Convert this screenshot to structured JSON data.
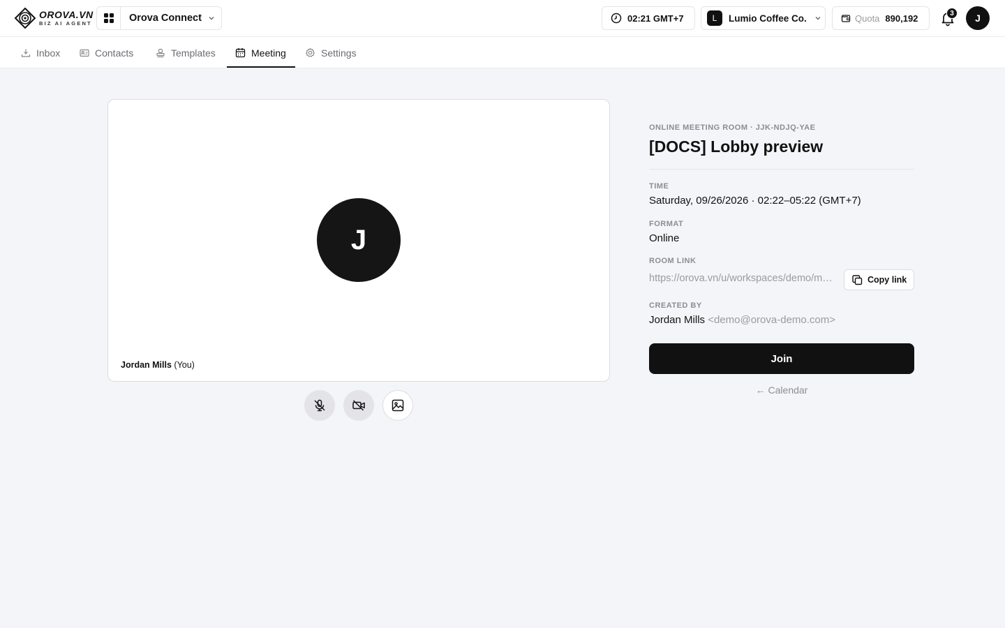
{
  "header": {
    "logo_main": "OROVA.VN",
    "logo_sub": "BIZ AI AGENT",
    "app_name": "Orova Connect",
    "time": "02:21 GMT+7",
    "org_initial": "L",
    "org_name": "Lumio Coffee Co.",
    "quota_label": "Quota",
    "quota_value": "890,192",
    "notification_count": "3",
    "user_initial": "J"
  },
  "tabs": [
    {
      "label": "Inbox",
      "icon": "inbox-icon",
      "active": false
    },
    {
      "label": "Contacts",
      "icon": "contact-card-icon",
      "active": false
    },
    {
      "label": "Templates",
      "icon": "stamp-icon",
      "active": false
    },
    {
      "label": "Meeting",
      "icon": "calendar-icon",
      "active": true
    },
    {
      "label": "Settings",
      "icon": "gear-icon",
      "active": false
    }
  ],
  "preview": {
    "avatar_initial": "J",
    "name": "Jordan Mills",
    "you_tag": "(You)",
    "mic_state": "muted",
    "camera_state": "off"
  },
  "meeting": {
    "room_id": "ONLINE MEETING ROOM · JJK-NDJQ-YAE",
    "title": "[DOCS] Lobby preview",
    "time_label": "TIME",
    "time_value": "Saturday, 09/26/2026 · 02:22–05:22 (GMT+7)",
    "format_label": "FORMAT",
    "format_value": "Online",
    "link_label": "ROOM LINK",
    "link_value": "https://orova.vn/u/workspaces/demo/meeting/jjk-ndjq-yae",
    "copy_label": "Copy link",
    "created_label": "CREATED BY",
    "creator_name": "Jordan Mills",
    "creator_email": "<demo@orova-demo.com>",
    "join_label": "Join",
    "back_label": "← Calendar"
  },
  "colors": {
    "accent": "#111111",
    "background": "#f4f5f8",
    "muted_text": "#8c8c94"
  }
}
